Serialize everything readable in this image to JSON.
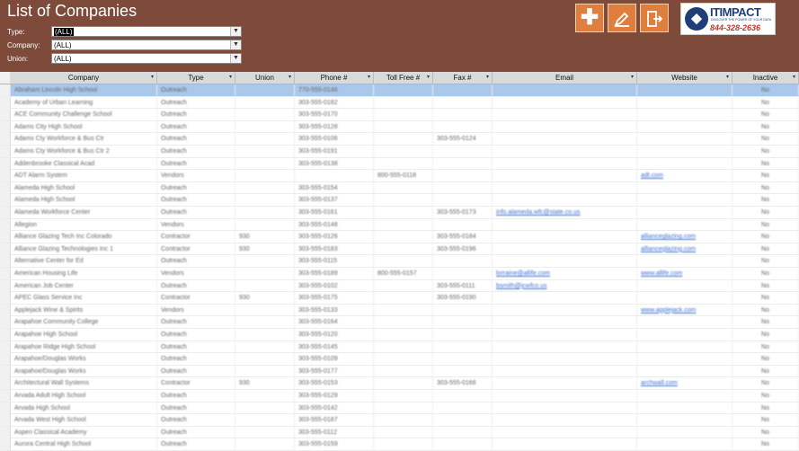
{
  "header": {
    "title": "List of Companies",
    "bg_color": "#7e4b3b",
    "accent_color": "#e07e3e"
  },
  "filters": [
    {
      "label": "Type:",
      "value": "(ALL)"
    },
    {
      "label": "Company:",
      "value": "(ALL)"
    },
    {
      "label": "Union:",
      "value": "(ALL)"
    }
  ],
  "actions": {
    "add_icon": "plus-icon",
    "edit_icon": "pencil-icon",
    "exit_icon": "exit-icon"
  },
  "logo": {
    "name": "ITIMPACT",
    "tagline": "DISCOVER THE POWER OF YOUR DATA",
    "phone": "844-328-2636"
  },
  "table": {
    "columns": [
      "Company",
      "Type",
      "Union",
      "Phone #",
      "Toll Free #",
      "Fax #",
      "Email",
      "Website",
      "Inactive"
    ],
    "rows": [
      [
        "Abraham Lincoln High School",
        "Outreach",
        "",
        "770-555-0146",
        "",
        "",
        "",
        "",
        "No"
      ],
      [
        "Academy of Urban Learning",
        "Outreach",
        "",
        "303-555-0182",
        "",
        "",
        "",
        "",
        "No"
      ],
      [
        "ACE Community Challenge School",
        "Outreach",
        "",
        "303-555-0170",
        "",
        "",
        "",
        "",
        "No"
      ],
      [
        "Adams City High School",
        "Outreach",
        "",
        "303-555-0128",
        "",
        "",
        "",
        "",
        "No"
      ],
      [
        "Adams Cty Workforce & Bus Ctr",
        "Outreach",
        "",
        "303-555-0106",
        "",
        "303-555-0124",
        "",
        "",
        "No"
      ],
      [
        "Adams Cty Workforce & Bus Ctr 2",
        "Outreach",
        "",
        "303-555-0191",
        "",
        "",
        "",
        "",
        "No"
      ],
      [
        "Addenbrooke Classical Acad",
        "Outreach",
        "",
        "303-555-0138",
        "",
        "",
        "",
        "",
        "No"
      ],
      [
        "ADT Alarm System",
        "Vendors",
        "",
        "",
        "800-555-0118",
        "",
        "",
        "adt.com",
        "No"
      ],
      [
        "Alameda High School",
        "Outreach",
        "",
        "303-555-0154",
        "",
        "",
        "",
        "",
        "No"
      ],
      [
        "Alameda High School",
        "Outreach",
        "",
        "303-555-0137",
        "",
        "",
        "",
        "",
        "No"
      ],
      [
        "Alameda Workforce Center",
        "Outreach",
        "",
        "303-555-0161",
        "",
        "303-555-0173",
        "info.alameda.wfc@state.co.us",
        "",
        "No"
      ],
      [
        "Allegion",
        "Vendors",
        "",
        "303-555-0148",
        "",
        "",
        "",
        "",
        "No"
      ],
      [
        "Alliance Glazing Tech Inc Colorado",
        "Contractor",
        "930",
        "303-555-0126",
        "",
        "303-555-0184",
        "",
        "allianceglazing.com",
        "No"
      ],
      [
        "Alliance Glazing Technologies Inc 1",
        "Contractor",
        "930",
        "303-555-0183",
        "",
        "303-555-0196",
        "",
        "allianceglazing.com",
        "No"
      ],
      [
        "Alternative Center for Ed",
        "Outreach",
        "",
        "303-555-0115",
        "",
        "",
        "",
        "",
        "No"
      ],
      [
        "American Housing Life",
        "Vendors",
        "",
        "303-555-0189",
        "800-555-0157",
        "",
        "lorraine@allife.com",
        "www.allife.com",
        "No"
      ],
      [
        "American Job Center",
        "Outreach",
        "",
        "303-555-0102",
        "",
        "303-555-0111",
        "bsmith@jcwfco.us",
        "",
        "No"
      ],
      [
        "APEC Glass Service Inc",
        "Contractor",
        "930",
        "303-555-0175",
        "",
        "303-555-0190",
        "",
        "",
        "No"
      ],
      [
        "Applejack Wine & Spirits",
        "Vendors",
        "",
        "303-555-0133",
        "",
        "",
        "",
        "www.applejack.com",
        "No"
      ],
      [
        "Arapahoe Community College",
        "Outreach",
        "",
        "303-555-0164",
        "",
        "",
        "",
        "",
        "No"
      ],
      [
        "Arapahoe High School",
        "Outreach",
        "",
        "303-555-0120",
        "",
        "",
        "",
        "",
        "No"
      ],
      [
        "Arapahoe Ridge High School",
        "Outreach",
        "",
        "303-555-0145",
        "",
        "",
        "",
        "",
        "No"
      ],
      [
        "Arapahoe/Douglas Works",
        "Outreach",
        "",
        "303-555-0109",
        "",
        "",
        "",
        "",
        "No"
      ],
      [
        "Arapahoe/Douglas Works",
        "Outreach",
        "",
        "303-555-0177",
        "",
        "",
        "",
        "",
        "No"
      ],
      [
        "Architectural Wall Systems",
        "Contractor",
        "930",
        "303-555-0153",
        "",
        "303-555-0166",
        "",
        "archwall.com",
        "No"
      ],
      [
        "Arvada Adult High School",
        "Outreach",
        "",
        "303-555-0129",
        "",
        "",
        "",
        "",
        "No"
      ],
      [
        "Arvada High School",
        "Outreach",
        "",
        "303-555-0142",
        "",
        "",
        "",
        "",
        "No"
      ],
      [
        "Arvada West High School",
        "Outreach",
        "",
        "303-555-0187",
        "",
        "",
        "",
        "",
        "No"
      ],
      [
        "Aspen Classical Academy",
        "Outreach",
        "",
        "303-555-0112",
        "",
        "",
        "",
        "",
        "No"
      ],
      [
        "Aurora Central High School",
        "Outreach",
        "",
        "303-555-0159",
        "",
        "",
        "",
        "",
        "No"
      ]
    ]
  }
}
